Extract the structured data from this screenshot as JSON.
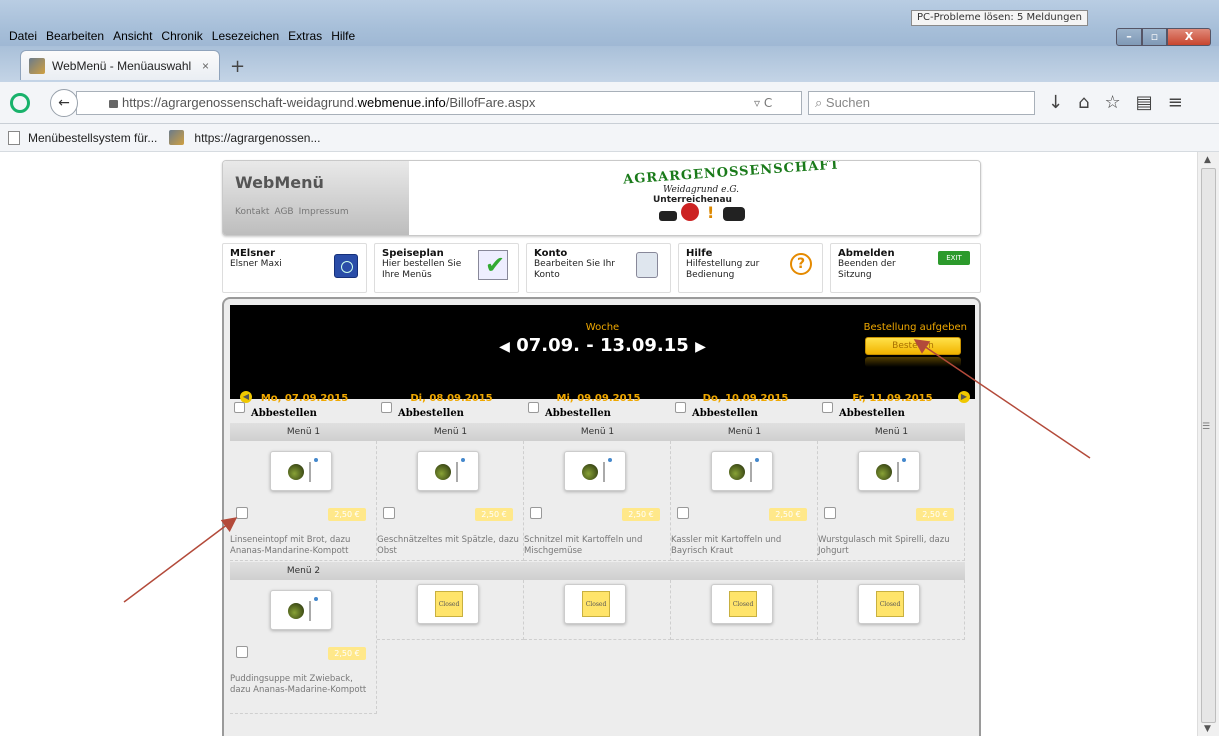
{
  "window": {
    "notification": "PC-Probleme lösen: 5 Meldungen",
    "min_glyph": "–",
    "max_glyph": "▫",
    "close_glyph": "X"
  },
  "menubar": [
    "Datei",
    "Bearbeiten",
    "Ansicht",
    "Chronik",
    "Lesezeichen",
    "Extras",
    "Hilfe"
  ],
  "tab": {
    "title": "WebMenü - Menüauswahl",
    "close": "×",
    "newtab": "+"
  },
  "nav": {
    "back_glyph": "←",
    "url_prefix": "https://agrargenossenschaft-weidagrund.",
    "url_host": "webmenue.info",
    "url_path": "/BillofFare.aspx",
    "url_tools": "▿ C",
    "search_placeholder": "Suchen",
    "icons": [
      "↓",
      "⌂",
      "☆",
      "▤",
      "≡"
    ]
  },
  "bookmarks": [
    "Menübestellsystem für...",
    "https://agrargenossen..."
  ],
  "header": {
    "app_title": "WebMenü",
    "links": [
      "Kontakt",
      "AGB",
      "Impressum"
    ],
    "logo_line1": "AGRARGENOSSENSCHAFT",
    "logo_line2": "Weidagrund e.G.",
    "logo_line3": "Unterreichenau",
    "logo_excl": "!"
  },
  "navboxes": [
    {
      "title": "MElsner",
      "text": "Elsner Maxi"
    },
    {
      "title": "Speiseplan",
      "text": "Hier bestellen Sie Ihre Menüs"
    },
    {
      "title": "Konto",
      "text": "Bearbeiten Sie Ihr Konto"
    },
    {
      "title": "Hilfe",
      "text": "Hilfestellung zur Bedienung"
    },
    {
      "title": "Abmelden",
      "text": "Beenden der Sitzung"
    }
  ],
  "help_glyph": "?",
  "exit_label": "EXIT",
  "week": {
    "label": "Woche",
    "range": "07.09. - 13.09.15",
    "prev_glyph": "◀",
    "next_glyph": "▶",
    "order_label": "Bestellung aufgeben",
    "order_button": "Bestellen"
  },
  "cancel_label": "Abbestellen",
  "days": [
    {
      "label": "Mo, 07.09.2015",
      "menu1": {
        "name": "Menü 1",
        "price": "2,50 €",
        "desc": "Linseneintopf mit Brot, dazu Ananas-Mandarine-Kompott"
      },
      "menu2": {
        "name": "Menü 2",
        "price": "2,50 €",
        "desc": "Puddingsuppe mit Zwieback, dazu Ananas-Madarine-Kompott",
        "closed": false
      }
    },
    {
      "label": "Di, 08.09.2015",
      "menu1": {
        "name": "Menü 1",
        "price": "2,50 €",
        "desc": "Geschnätzeltes mit Spätzle, dazu Obst"
      },
      "menu2": {
        "closed": true,
        "closed_label": "Closed"
      }
    },
    {
      "label": "Mi, 09.09.2015",
      "menu1": {
        "name": "Menü 1",
        "price": "2,50 €",
        "desc": "Schnitzel mit Kartoffeln und Mischgemüse"
      },
      "menu2": {
        "closed": true,
        "closed_label": "Closed"
      }
    },
    {
      "label": "Do, 10.09.2015",
      "menu1": {
        "name": "Menü 1",
        "price": "2,50 €",
        "desc": "Kassler mit Kartoffeln und Bayrisch Kraut"
      },
      "menu2": {
        "closed": true,
        "closed_label": "Closed"
      }
    },
    {
      "label": "Fr, 11.09.2015",
      "menu1": {
        "name": "Menü 1",
        "price": "2,50 €",
        "desc": "Wurstgulasch mit Spirelli, dazu Johgurt"
      },
      "menu2": {
        "closed": true,
        "closed_label": "Closed"
      }
    }
  ],
  "colors": {
    "accent": "#f0a800",
    "annotation_arrow": "#b34a3a",
    "exit_green": "#2c9a2c"
  }
}
